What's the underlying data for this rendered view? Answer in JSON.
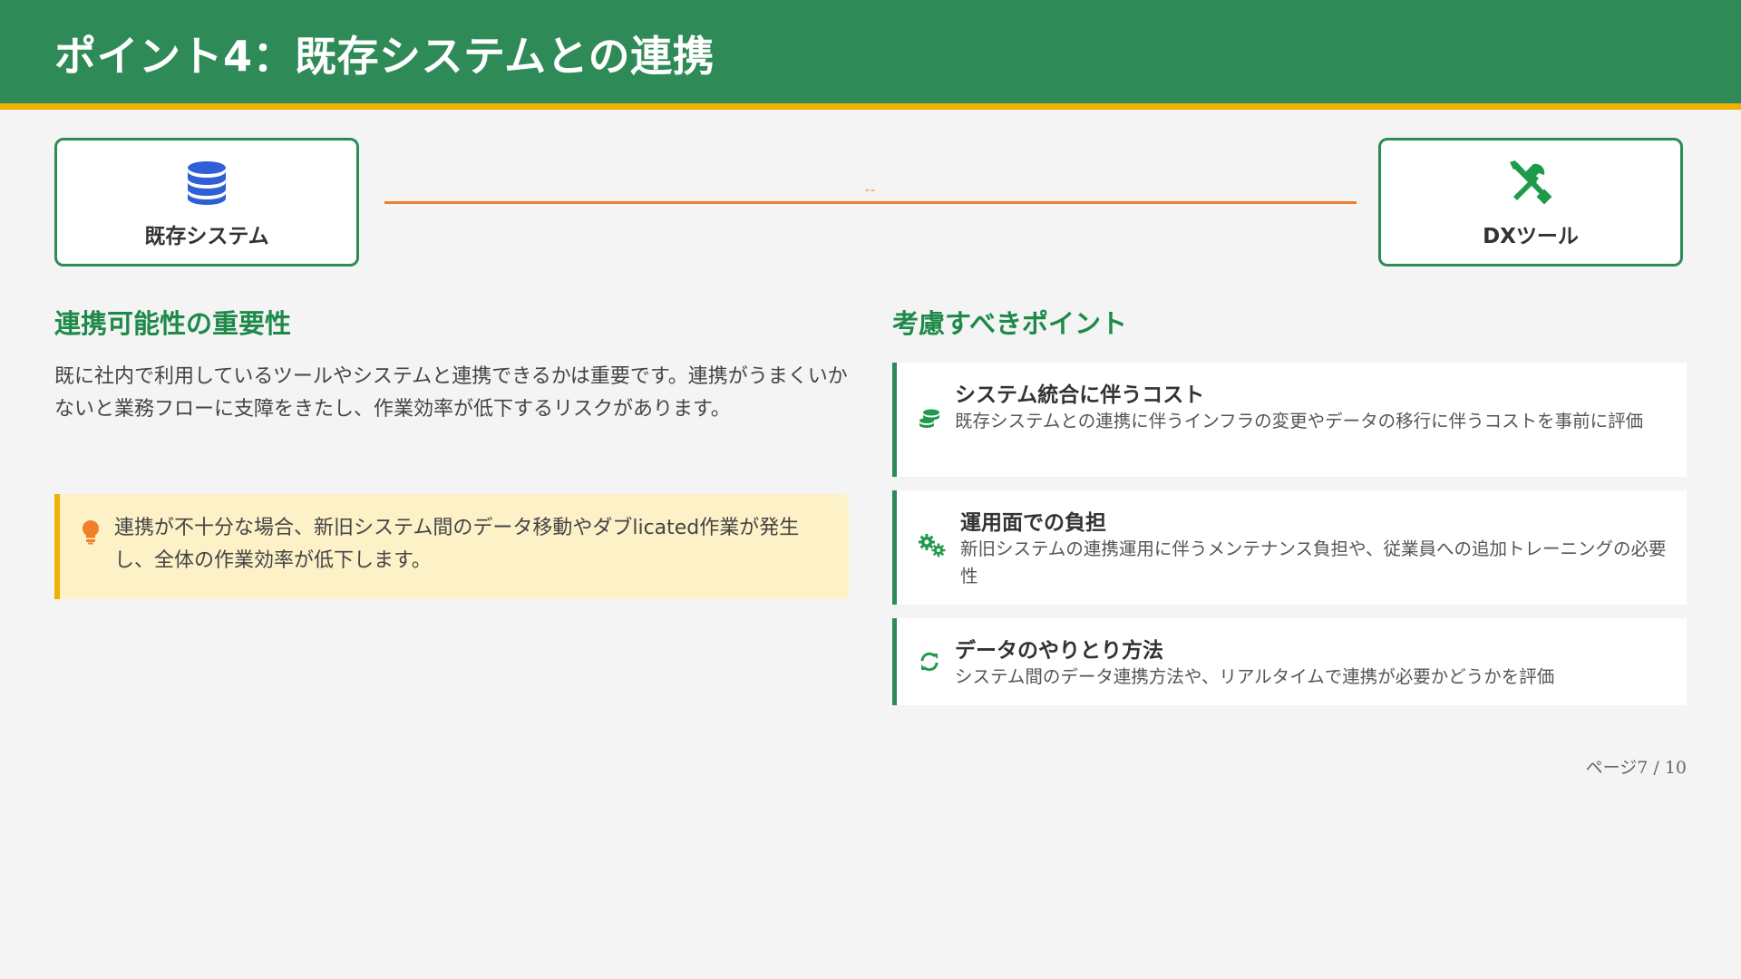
{
  "slide": {
    "title": "ポイント4：既存システムとの連携",
    "page_indicator": "ページ7 / 10"
  },
  "colors": {
    "header_bg": "#2e8b57",
    "header_stripe": "#f0b000",
    "accent_green": "#1e8a4a",
    "connector_orange": "#f07f2a",
    "tip_bg": "#fdf1c8",
    "database_icon_blue": "#2f5fd6"
  },
  "diagram": {
    "left_box": {
      "label": "既存システム",
      "icon": "database-icon"
    },
    "right_box": {
      "label": "DXツール",
      "icon": "tools-icon"
    },
    "connector_label": "--"
  },
  "left_section": {
    "title": "連携可能性の重要性",
    "body": "既に社内で利用しているツールやシステムと連携できるかは重要です。連携がうまくいかないと業務フローに支障をきたし、作業効率が低下するリスクがあります。",
    "tip": {
      "icon": "lightbulb-icon",
      "text": "連携が不十分な場合、新旧システム間のデータ移動やダブlicated作業が発生し、全体の作業効率が低下します。"
    }
  },
  "right_section": {
    "title": "考慮すべきポイント",
    "points": [
      {
        "icon": "coins-icon",
        "title": "システム統合に伴うコスト",
        "description": "既存システムとの連携に伴うインフラの変更やデータの移行に伴うコストを事前に評価"
      },
      {
        "icon": "cogs-icon",
        "title": "運用面での負担",
        "description": "新旧システムの連携運用に伴うメンテナンス負担や、従業員への追加トレーニングの必要性"
      },
      {
        "icon": "sync-icon",
        "title": "データのやりとり方法",
        "description": "システム間のデータ連携方法や、リアルタイムで連携が必要かどうかを評価"
      }
    ]
  }
}
